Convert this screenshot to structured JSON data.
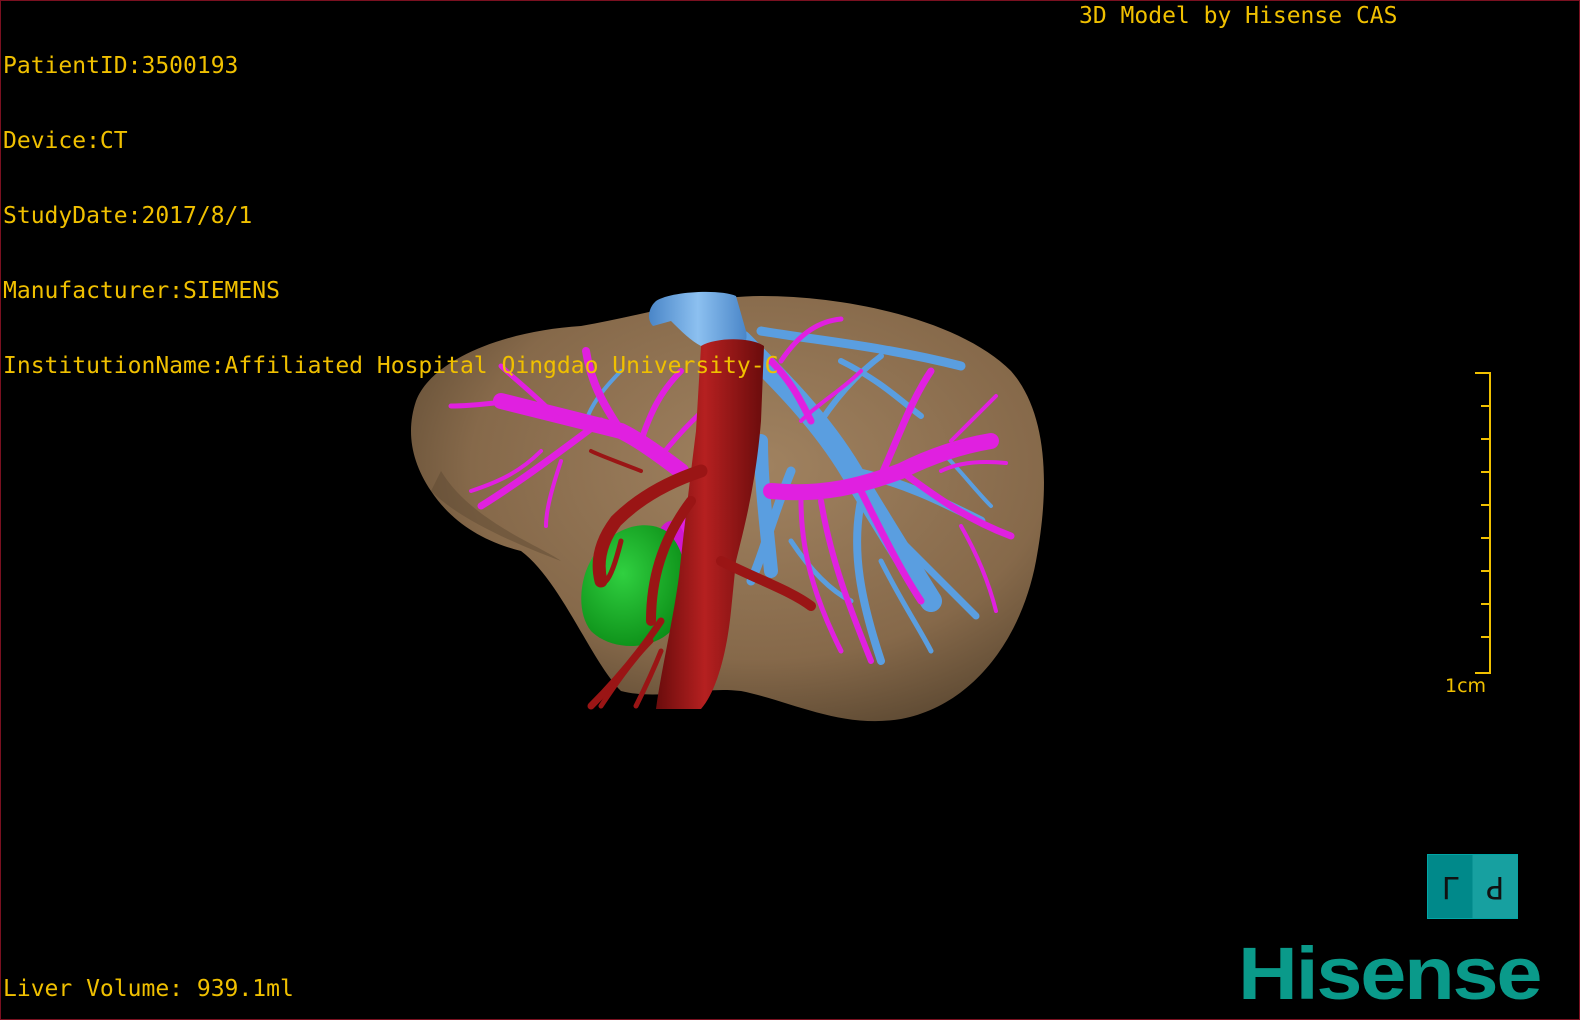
{
  "info": {
    "patient_id": "PatientID:3500193",
    "device": "Device:CT",
    "study_date": "StudyDate:2017/8/1",
    "manufacturer": "Manufacturer:SIEMENS",
    "institution": "InstitutionName:Affiliated Hospital Qingdao University-C"
  },
  "credit": "3D Model by Hisense CAS",
  "liver_volume": "Liver Volume: 939.1ml",
  "scale_label": "1cm",
  "orientation": {
    "left_face": "L",
    "right_face": "P"
  },
  "brand": "Hisense",
  "colors": {
    "overlay_text": "#f0c000",
    "liver": "#8a7050",
    "portal_vein": "#e020e0",
    "hepatic_vein": "#5a9ee0",
    "artery": "#a01818",
    "gallbladder": "#10b020",
    "brand": "#0a9a8a",
    "frame": "#7a1020"
  },
  "model": {
    "structures": [
      "liver-icon",
      "vena-cava-icon",
      "portal-vein-icon",
      "hepatic-vein-icon",
      "aorta-icon",
      "gallbladder-icon"
    ]
  }
}
